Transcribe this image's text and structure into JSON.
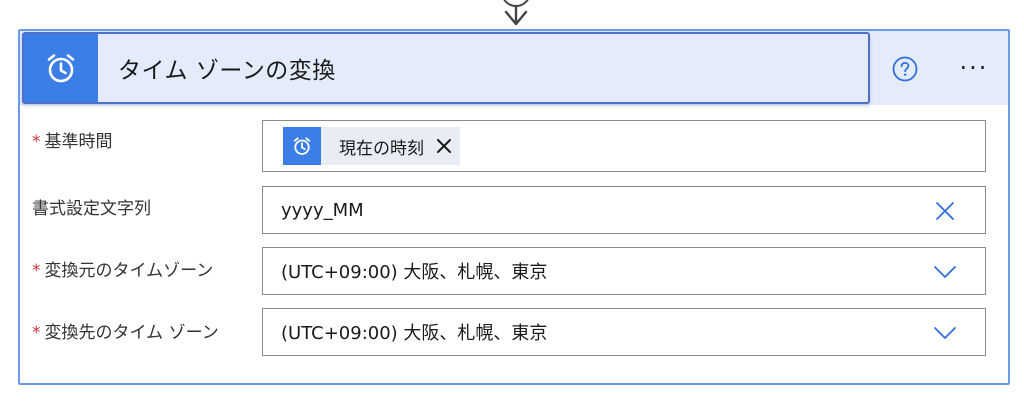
{
  "card": {
    "title": "タイム ゾーンの変換",
    "title_icon": "alarm-clock-icon",
    "help_icon": "help-circle-icon",
    "more_label": "···"
  },
  "fields": [
    {
      "label": "基準時間",
      "required": true,
      "token": {
        "label": "現在の時刻",
        "icon": "alarm-clock-icon"
      }
    },
    {
      "label": "書式設定文字列",
      "required": false,
      "value": "yyyy_MM",
      "action_icon": "clear-icon"
    },
    {
      "label": "変換元のタイムゾーン",
      "required": true,
      "value": "(UTC+09:00) 大阪、札幌、東京",
      "action_icon": "chevron-down-icon"
    },
    {
      "label": "変換先のタイム ゾーン",
      "required": true,
      "value": "(UTC+09:00) 大阪、札幌、東京",
      "action_icon": "chevron-down-icon"
    }
  ],
  "required_marker": "*",
  "colors": {
    "accent": "#3b7ee6",
    "header_bg": "#e4ebfb",
    "card_border": "#6d9ae6",
    "required": "#d13438",
    "token_bg": "#e7ecf5"
  }
}
